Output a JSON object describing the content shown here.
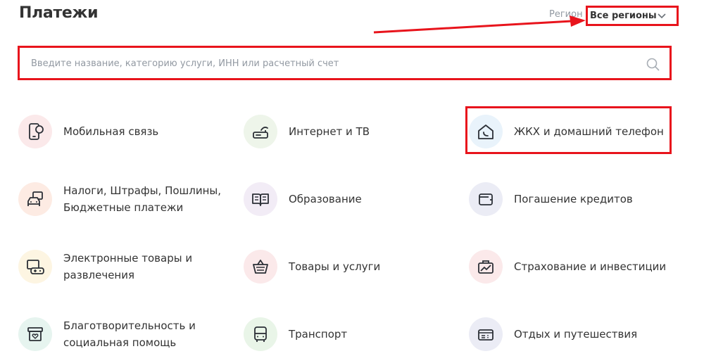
{
  "header": {
    "title": "Платежи",
    "region_label": "Регион",
    "region_value": "Все регионы"
  },
  "search": {
    "placeholder": "Введите название, категорию услуги, ИНН или расчетный счет",
    "value": ""
  },
  "colors": {
    "highlight": "#e8141c",
    "text": "#333333",
    "muted": "#9299a2"
  },
  "categories": [
    {
      "label": "Мобильная связь",
      "icon": "mobile-phone-icon",
      "bg": "#fbe9ea"
    },
    {
      "label": "Интернет и ТВ",
      "icon": "router-icon",
      "bg": "#eef5ea"
    },
    {
      "label": "ЖКХ и домашний телефон",
      "icon": "house-phone-icon",
      "bg": "#e9f3fb"
    },
    {
      "label": "Налоги, Штрафы, Пошлины, Бюджетные платежи",
      "icon": "car-document-icon",
      "bg": "#fdebe3"
    },
    {
      "label": "Образование",
      "icon": "book-icon",
      "bg": "#f2ecf6"
    },
    {
      "label": "Погашение кредитов",
      "icon": "wallet-icon",
      "bg": "#ebecf5"
    },
    {
      "label": "Электронные товары и развлечения",
      "icon": "gamepad-icon",
      "bg": "#fdf5e2"
    },
    {
      "label": "Товары и услуги",
      "icon": "basket-icon",
      "bg": "#fbe9ea"
    },
    {
      "label": "Страхование и инвестиции",
      "icon": "briefcase-chart-icon",
      "bg": "#fbe9ea"
    },
    {
      "label": "Благотворительность и социальная помощь",
      "icon": "charity-box-icon",
      "bg": "#e6f4ef"
    },
    {
      "label": "Транспорт",
      "icon": "bus-icon",
      "bg": "#e9f5e8"
    },
    {
      "label": "Отдых и путешествия",
      "icon": "ticket-icon",
      "bg": "#ebecf5"
    }
  ]
}
